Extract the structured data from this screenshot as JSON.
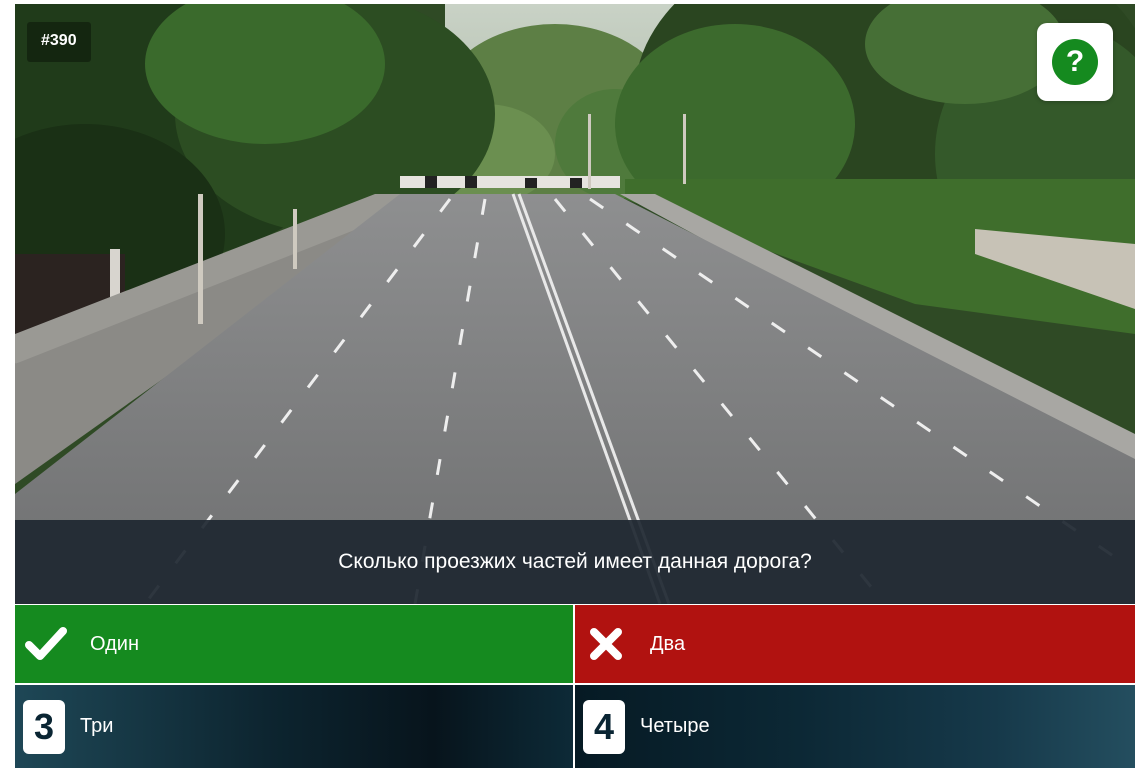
{
  "question": {
    "number": "#390",
    "text": "Сколько проезжих частей имеет данная дорога?"
  },
  "help": {
    "icon": "question-icon",
    "glyph": "?"
  },
  "answers": [
    {
      "label": "Один",
      "status": "correct",
      "icon": "checkmark-icon",
      "color": "#158a1f"
    },
    {
      "label": "Два",
      "status": "wrong",
      "icon": "cross-icon",
      "color": "#b11210"
    },
    {
      "number": "3",
      "label": "Три",
      "status": "neutral"
    },
    {
      "number": "4",
      "label": "Четыре",
      "status": "neutral"
    }
  ]
}
